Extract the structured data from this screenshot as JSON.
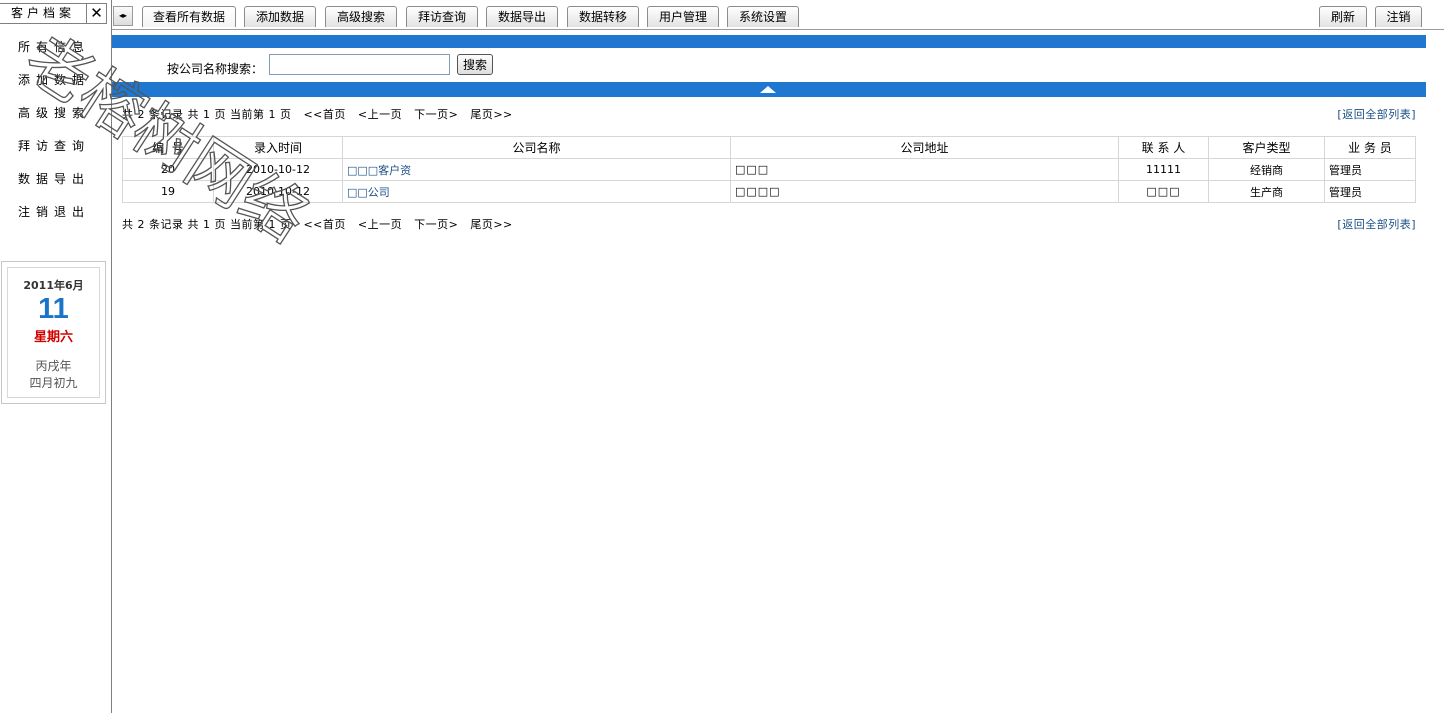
{
  "sidebar": {
    "title": "客户档案",
    "close_label": "✕",
    "items": [
      {
        "label": "所有信息"
      },
      {
        "label": "添加数据"
      },
      {
        "label": "高级搜索"
      },
      {
        "label": "拜访查询"
      },
      {
        "label": "数据导出"
      },
      {
        "label": "注销退出"
      }
    ]
  },
  "calendar": {
    "year_month": "2011年6月",
    "day": "11",
    "weekday": "星期六",
    "lunar_year": "丙戌年",
    "lunar_day": "四月初九"
  },
  "toolbar": {
    "toggle_label": "◂▸",
    "tabs": [
      {
        "label": "查看所有数据"
      },
      {
        "label": "添加数据"
      },
      {
        "label": "高级搜索"
      },
      {
        "label": "拜访查询"
      },
      {
        "label": "数据导出"
      },
      {
        "label": "数据转移"
      },
      {
        "label": "用户管理"
      },
      {
        "label": "系统设置"
      }
    ],
    "refresh_label": "刷新",
    "logout_label": "注销"
  },
  "search": {
    "label": "按公司名称搜索：",
    "value": "",
    "button_label": "搜索"
  },
  "pager": {
    "summary": "共 2 条记录 共 1 页 当前第 1 页",
    "first": "<<首页",
    "prev": "<上一页",
    "next": "下一页>",
    "last": "尾页>>",
    "back_all": "[返回全部列表]"
  },
  "table": {
    "headers": [
      "编  号",
      "录入时间",
      "公司名称",
      "公司地址",
      "联 系 人",
      "客户类型",
      "业 务 员"
    ],
    "rows": [
      [
        "20",
        "2010-10-12",
        "□□□客户资",
        "□□□",
        "11111",
        "经销商",
        "管理员"
      ],
      [
        "19",
        "2010-10-12",
        "□□公司",
        "□□□□",
        "□□□",
        "生产商",
        "管理员"
      ]
    ]
  },
  "watermark": {
    "text": "老榕树网络"
  }
}
